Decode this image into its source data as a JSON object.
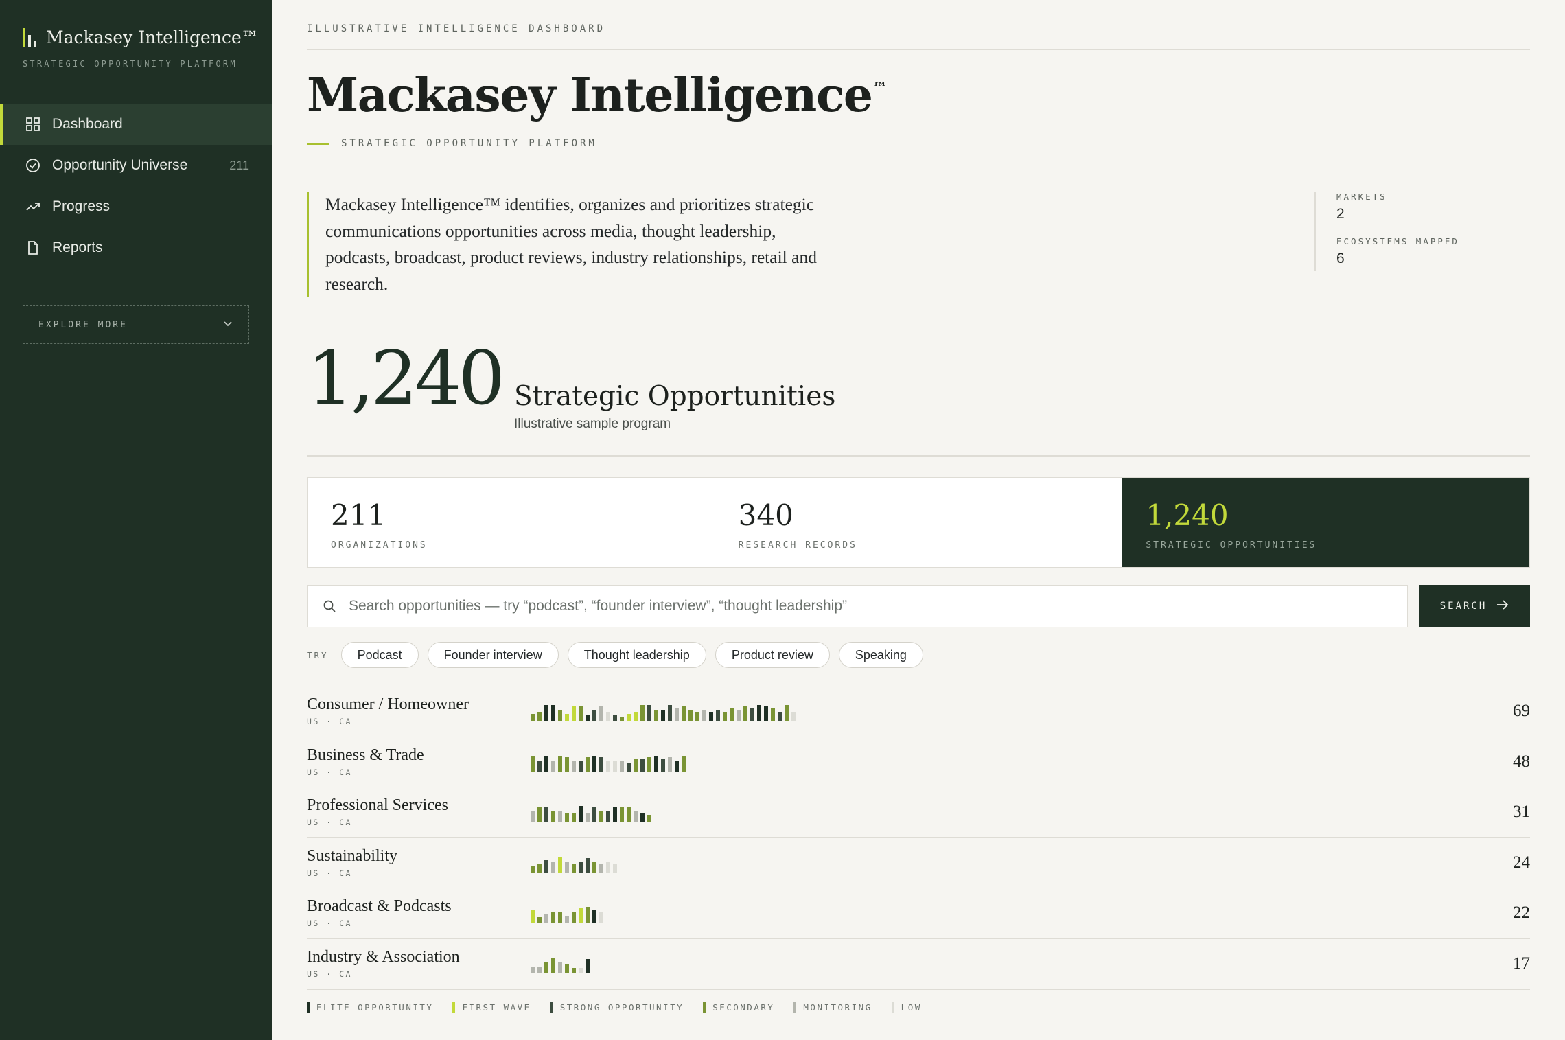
{
  "sidebar": {
    "brand_name": "Mackasey Intelligence™",
    "brand_tagline": "STRATEGIC OPPORTUNITY PLATFORM",
    "nav": [
      {
        "label": "Dashboard",
        "icon": "grid-icon",
        "count": ""
      },
      {
        "label": "Opportunity Universe",
        "icon": "check-circle-icon",
        "count": "211"
      },
      {
        "label": "Progress",
        "icon": "trending-up-icon",
        "count": ""
      },
      {
        "label": "Reports",
        "icon": "file-icon",
        "count": ""
      }
    ],
    "explore_label": "EXPLORE MORE"
  },
  "header": {
    "eyebrow": "ILLUSTRATIVE INTELLIGENCE DASHBOARD",
    "title": "Mackasey Intelligence",
    "title_mark": "™",
    "subtitle": "STRATEGIC OPPORTUNITY PLATFORM"
  },
  "intro": {
    "text": "Mackasey Intelligence™ identifies, organizes and prioritizes strategic communications opportunities across media, thought leadership, podcasts, broadcast, product reviews, industry relationships, retail and research.",
    "stats": [
      {
        "label": "MARKETS",
        "value": "2"
      },
      {
        "label": "ECOSYSTEMS MAPPED",
        "value": "6"
      }
    ]
  },
  "headline": {
    "number": "1,240",
    "label": "Strategic Opportunities",
    "sub": "Illustrative sample program"
  },
  "kpis": [
    {
      "value": "211",
      "label": "ORGANIZATIONS"
    },
    {
      "value": "340",
      "label": "RESEARCH RECORDS"
    },
    {
      "value": "1,240",
      "label": "STRATEGIC OPPORTUNITIES"
    }
  ],
  "search": {
    "placeholder": "Search opportunities — try “podcast”, “founder interview”, “thought leadership”",
    "value": "",
    "button_label": "SEARCH"
  },
  "try": {
    "label": "TRY",
    "chips": [
      "Podcast",
      "Founder interview",
      "Thought leadership",
      "Product review",
      "Speaking"
    ]
  },
  "tiers": {
    "E": {
      "label": "ELITE OPPORTUNITY",
      "color": "#1f3025"
    },
    "F": {
      "label": "FIRST WAVE",
      "color": "#c2d93a"
    },
    "S": {
      "label": "STRONG OPPORTUNITY",
      "color": "#3d4d40"
    },
    "C": {
      "label": "SECONDARY",
      "color": "#7a9434"
    },
    "M": {
      "label": "MONITORING",
      "color": "#b3b5ad"
    },
    "L": {
      "label": "LOW",
      "color": "#dcdcd5"
    }
  },
  "tier_order": [
    "E",
    "F",
    "S",
    "C",
    "M",
    "L"
  ],
  "ecosystems": [
    {
      "name": "Consumer / Homeowner",
      "markets": "US · CA",
      "count": "69",
      "bars": "CCEECFFCESMLSCFFCSCESMCCCMESCCMCSEECSCL",
      "levels": [
        0.4,
        0.5,
        0.9,
        0.9,
        0.6,
        0.4,
        0.8,
        0.8,
        0.3,
        0.6,
        0.8,
        0.5,
        0.3,
        0.2,
        0.4,
        0.5,
        0.9,
        0.9,
        0.6,
        0.6,
        0.9,
        0.7,
        0.8,
        0.6,
        0.5,
        0.6,
        0.5,
        0.6,
        0.5,
        0.7,
        0.6,
        0.8,
        0.7,
        0.9,
        0.8,
        0.7,
        0.5,
        0.9,
        0.5
      ]
    },
    {
      "name": "Business & Trade",
      "markets": "US · CA",
      "count": "48",
      "bars": "CSEMCCMSCESLLMSCSCESMEC",
      "levels": [
        0.9,
        0.6,
        0.9,
        0.6,
        0.9,
        0.8,
        0.6,
        0.6,
        0.8,
        0.9,
        0.8,
        0.6,
        0.6,
        0.6,
        0.5,
        0.7,
        0.7,
        0.8,
        0.9,
        0.7,
        0.8,
        0.6,
        0.9
      ]
    },
    {
      "name": "Professional Services",
      "markets": "US · CA",
      "count": "31",
      "bars": "MCSCMCCEMSCSECCMEC",
      "levels": [
        0.6,
        0.8,
        0.8,
        0.6,
        0.6,
        0.5,
        0.5,
        0.9,
        0.5,
        0.8,
        0.6,
        0.6,
        0.8,
        0.8,
        0.8,
        0.6,
        0.5,
        0.4
      ]
    },
    {
      "name": "Sustainability",
      "markets": "US · CA",
      "count": "24",
      "bars": "CCSMFMCSSCMLL",
      "levels": [
        0.4,
        0.5,
        0.7,
        0.6,
        0.9,
        0.6,
        0.5,
        0.6,
        0.8,
        0.6,
        0.5,
        0.6,
        0.5
      ]
    },
    {
      "name": "Broadcast & Podcasts",
      "markets": "US · CA",
      "count": "22",
      "bars": "FCMCCMCFCEL",
      "levels": [
        0.7,
        0.3,
        0.5,
        0.6,
        0.6,
        0.4,
        0.6,
        0.8,
        0.9,
        0.7,
        0.6
      ]
    },
    {
      "name": "Industry & Association",
      "markets": "US · CA",
      "count": "17",
      "bars": "MMCCMCCLE",
      "levels": [
        0.4,
        0.4,
        0.6,
        0.9,
        0.6,
        0.5,
        0.3,
        0.3,
        0.8
      ]
    }
  ]
}
